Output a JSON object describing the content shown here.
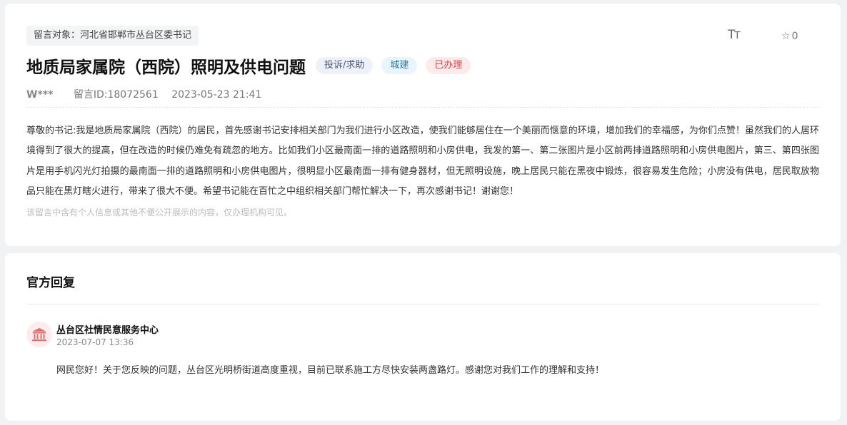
{
  "message": {
    "target_label": "留言对象：河北省邯郸市丛台区委书记",
    "font_size_icon": "text-size-icon",
    "favorite_icon": "star-icon",
    "favorite_count": "0",
    "title": "地质局家属院（西院）照明及供电问题",
    "tags": {
      "type": "投诉/求助",
      "category": "城建",
      "status": "已办理"
    },
    "author": "W***",
    "message_id": "留言ID:18072561",
    "datetime": "2023-05-23 21:41",
    "content": "尊敬的书记:我是地质局家属院（西院）的居民，首先感谢书记安排相关部门为我们进行小区改造，使我们能够居住在一个美丽而惬意的环境，增加我们的幸福感，为你们点赞！虽然我们的人居环境得到了很大的提高，但在改造的时候仍难免有疏忽的地方。比如我们小区最南面一排的道路照明和小房供电，我发的第一、第二张图片是小区前两排道路照明和小房供电图片，第三、第四张图片是用手机闪光灯拍摄的最南面一排的道路照明和小房供电图片，很明显小区最南面一排有健身器材，但无照明设施，晚上居民只能在黑夜中锻炼，很容易发生危险；小房没有供电，居民取放物品只能在黑灯瞎火进行，带来了很大不便。希望书记能在百忙之中组织相关部门帮忙解决一下，再次感谢书记！谢谢您！",
    "privacy_note": "该留言中含有个人信息或其他不便公开展示的内容，仅办理机构可见。"
  },
  "reply": {
    "section_title": "官方回复",
    "avatar_icon": "government-building-icon",
    "org_name": "丛台区社情民意服务中心",
    "datetime": "2023-07-07 13:36",
    "content": "网民您好！关于您反映的问题，丛台区光明桥街道高度重视，目前已联系施工方尽快安装两盏路灯。感谢您对我们工作的理解和支持！"
  },
  "colors": {
    "status_red": "#e0454a",
    "category_blue": "#2d7ba6",
    "avatar_bg": "#fdecec",
    "avatar_icon": "#e26b6b"
  }
}
